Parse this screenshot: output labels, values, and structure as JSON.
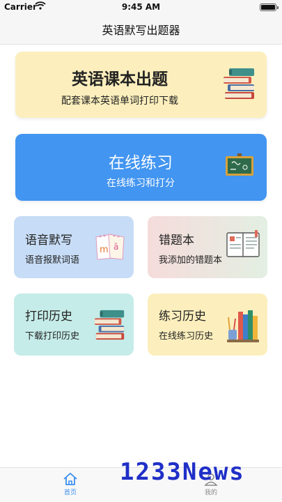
{
  "status_bar": {
    "carrier": "Carrier",
    "time": "9:45 AM"
  },
  "nav": {
    "title": "英语默写出题器"
  },
  "cards": {
    "textbook": {
      "title": "英语课本出题",
      "subtitle": "配套课本英语单词打印下载",
      "icon": "books-stack-icon"
    },
    "online": {
      "title": "在线练习",
      "subtitle": "在线练习和打分",
      "icon": "chalkboard-icon"
    },
    "voice": {
      "title": "语音默写",
      "subtitle": "语音报默词语",
      "icon": "phonetic-calendar-icon"
    },
    "mistakes": {
      "title": "错题本",
      "subtitle": "我添加的错题本",
      "icon": "notebook-icon"
    },
    "print_history": {
      "title": "打印历史",
      "subtitle": "下载打印历史",
      "icon": "books-stack-icon"
    },
    "practice_history": {
      "title": "练习历史",
      "subtitle": "在线练习历史",
      "icon": "desk-supplies-icon"
    }
  },
  "tabbar": {
    "home_label": "首页",
    "mine_label": "我的",
    "active_color": "#3b8ef0",
    "inactive_color": "#8a8a8a"
  },
  "watermark": "1233News",
  "colors": {
    "textbook_bg": "#fcefbd",
    "online_bg": "#4295f0",
    "voice_bg": "#c7dcf6",
    "print_history_bg": "#c5ece8",
    "practice_history_bg": "#fcefbd"
  }
}
